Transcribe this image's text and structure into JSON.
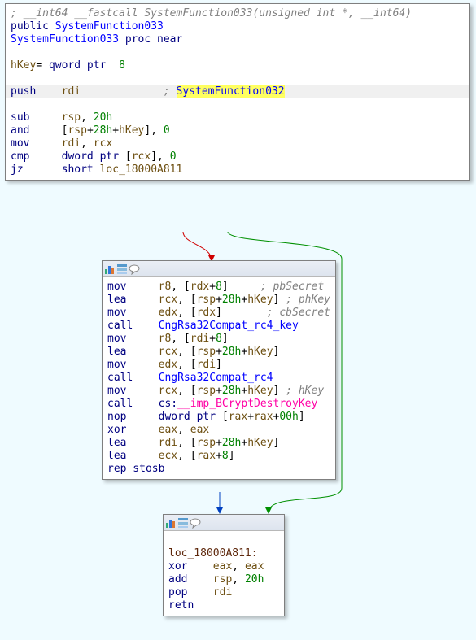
{
  "block1": {
    "comment": "; __int64 __fastcall SystemFunction033(unsigned int *, __int64)",
    "public": "public",
    "name1": "SystemFunction033",
    "procnear": "proc near",
    "hkeyDecl": "hKey= qword ptr  8",
    "lines": [
      {
        "op": "push",
        "args": [
          {
            "t": "rdi",
            "c": "id"
          }
        ],
        "cmt": "SystemFunction032",
        "hl": true,
        "sel": true
      },
      {
        "op": "sub",
        "args": [
          {
            "t": "rsp",
            "c": "id"
          },
          {
            "t": ", ",
            "c": "black"
          },
          {
            "t": "20h",
            "c": "num"
          }
        ]
      },
      {
        "op": "and",
        "args": [
          {
            "t": "[",
            "c": "black"
          },
          {
            "t": "rsp",
            "c": "id"
          },
          {
            "t": "+",
            "c": "black"
          },
          {
            "t": "28h",
            "c": "num"
          },
          {
            "t": "+",
            "c": "black"
          },
          {
            "t": "hKey",
            "c": "id"
          },
          {
            "t": "], ",
            "c": "black"
          },
          {
            "t": "0",
            "c": "num"
          }
        ]
      },
      {
        "op": "mov",
        "args": [
          {
            "t": "rdi",
            "c": "id"
          },
          {
            "t": ", ",
            "c": "black"
          },
          {
            "t": "rcx",
            "c": "id"
          }
        ]
      },
      {
        "op": "cmp",
        "args": [
          {
            "t": "dword ptr ",
            "c": "kw"
          },
          {
            "t": "[",
            "c": "black"
          },
          {
            "t": "rcx",
            "c": "id"
          },
          {
            "t": "], ",
            "c": "black"
          },
          {
            "t": "0",
            "c": "num"
          }
        ]
      },
      {
        "op": "jz",
        "args": [
          {
            "t": "short ",
            "c": "kw"
          },
          {
            "t": "loc_18000A811",
            "c": "id"
          }
        ]
      }
    ]
  },
  "block2": {
    "lines": [
      {
        "op": "mov",
        "args": [
          {
            "t": "r8",
            "c": "id"
          },
          {
            "t": ", [",
            "c": "black"
          },
          {
            "t": "rdx",
            "c": "id"
          },
          {
            "t": "+",
            "c": "black"
          },
          {
            "t": "8",
            "c": "num"
          },
          {
            "t": "]",
            "c": "black"
          }
        ],
        "cmt": "pbSecret",
        "cmtPad": 5
      },
      {
        "op": "lea",
        "args": [
          {
            "t": "rcx",
            "c": "id"
          },
          {
            "t": ", [",
            "c": "black"
          },
          {
            "t": "rsp",
            "c": "id"
          },
          {
            "t": "+",
            "c": "black"
          },
          {
            "t": "28h",
            "c": "num"
          },
          {
            "t": "+",
            "c": "black"
          },
          {
            "t": "hKey",
            "c": "id"
          },
          {
            "t": "]",
            "c": "black"
          }
        ],
        "cmt": "phKey"
      },
      {
        "op": "mov",
        "args": [
          {
            "t": "edx",
            "c": "id"
          },
          {
            "t": ", [",
            "c": "black"
          },
          {
            "t": "rdx",
            "c": "id"
          },
          {
            "t": "]",
            "c": "black"
          }
        ],
        "cmt": "cbSecret",
        "cmtPad": 7
      },
      {
        "op": "call",
        "args": [
          {
            "t": "CngRsa32Compat_rc4_key",
            "c": "func"
          }
        ]
      },
      {
        "op": "mov",
        "args": [
          {
            "t": "r8",
            "c": "id"
          },
          {
            "t": ", [",
            "c": "black"
          },
          {
            "t": "rdi",
            "c": "id"
          },
          {
            "t": "+",
            "c": "black"
          },
          {
            "t": "8",
            "c": "num"
          },
          {
            "t": "]",
            "c": "black"
          }
        ]
      },
      {
        "op": "lea",
        "args": [
          {
            "t": "rcx",
            "c": "id"
          },
          {
            "t": ", [",
            "c": "black"
          },
          {
            "t": "rsp",
            "c": "id"
          },
          {
            "t": "+",
            "c": "black"
          },
          {
            "t": "28h",
            "c": "num"
          },
          {
            "t": "+",
            "c": "black"
          },
          {
            "t": "hKey",
            "c": "id"
          },
          {
            "t": "]",
            "c": "black"
          }
        ]
      },
      {
        "op": "mov",
        "args": [
          {
            "t": "edx",
            "c": "id"
          },
          {
            "t": ", [",
            "c": "black"
          },
          {
            "t": "rdi",
            "c": "id"
          },
          {
            "t": "]",
            "c": "black"
          }
        ]
      },
      {
        "op": "call",
        "args": [
          {
            "t": "CngRsa32Compat_rc4",
            "c": "func"
          }
        ]
      },
      {
        "op": "mov",
        "args": [
          {
            "t": "rcx",
            "c": "id"
          },
          {
            "t": ", [",
            "c": "black"
          },
          {
            "t": "rsp",
            "c": "id"
          },
          {
            "t": "+",
            "c": "black"
          },
          {
            "t": "28h",
            "c": "num"
          },
          {
            "t": "+",
            "c": "black"
          },
          {
            "t": "hKey",
            "c": "id"
          },
          {
            "t": "]",
            "c": "black"
          }
        ],
        "cmt": "hKey"
      },
      {
        "op": "call",
        "args": [
          {
            "t": "cs:",
            "c": "kw"
          },
          {
            "t": "__imp_BCryptDestroyKey",
            "c": "imp"
          }
        ]
      },
      {
        "op": "nop",
        "args": [
          {
            "t": "dword ptr ",
            "c": "kw"
          },
          {
            "t": "[",
            "c": "black"
          },
          {
            "t": "rax",
            "c": "id"
          },
          {
            "t": "+",
            "c": "black"
          },
          {
            "t": "rax",
            "c": "id"
          },
          {
            "t": "+",
            "c": "black"
          },
          {
            "t": "00h",
            "c": "num"
          },
          {
            "t": "]",
            "c": "black"
          }
        ]
      },
      {
        "op": "xor",
        "args": [
          {
            "t": "eax",
            "c": "id"
          },
          {
            "t": ", ",
            "c": "black"
          },
          {
            "t": "eax",
            "c": "id"
          }
        ]
      },
      {
        "op": "lea",
        "args": [
          {
            "t": "rdi",
            "c": "id"
          },
          {
            "t": ", [",
            "c": "black"
          },
          {
            "t": "rsp",
            "c": "id"
          },
          {
            "t": "+",
            "c": "black"
          },
          {
            "t": "28h",
            "c": "num"
          },
          {
            "t": "+",
            "c": "black"
          },
          {
            "t": "hKey",
            "c": "id"
          },
          {
            "t": "]",
            "c": "black"
          }
        ]
      },
      {
        "op": "lea",
        "args": [
          {
            "t": "ecx",
            "c": "id"
          },
          {
            "t": ", [",
            "c": "black"
          },
          {
            "t": "rax",
            "c": "id"
          },
          {
            "t": "+",
            "c": "black"
          },
          {
            "t": "8",
            "c": "num"
          },
          {
            "t": "]",
            "c": "black"
          }
        ]
      },
      {
        "op": "rep stosb",
        "args": []
      }
    ]
  },
  "block3": {
    "label": "loc_18000A811:",
    "lines": [
      {
        "op": "xor",
        "args": [
          {
            "t": "eax",
            "c": "id"
          },
          {
            "t": ", ",
            "c": "black"
          },
          {
            "t": "eax",
            "c": "id"
          }
        ]
      },
      {
        "op": "add",
        "args": [
          {
            "t": "rsp",
            "c": "id"
          },
          {
            "t": ", ",
            "c": "black"
          },
          {
            "t": "20h",
            "c": "num"
          }
        ]
      },
      {
        "op": "pop",
        "args": [
          {
            "t": "rdi",
            "c": "id"
          }
        ]
      },
      {
        "op": "retn",
        "args": []
      }
    ]
  }
}
